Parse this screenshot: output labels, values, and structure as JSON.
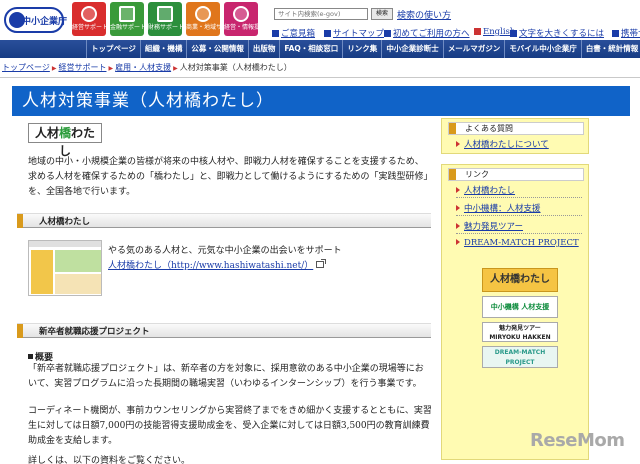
{
  "header": {
    "logo_text": "中小企業庁",
    "categories": [
      {
        "label": "経営サポート",
        "color": "#d92d2d"
      },
      {
        "label": "金融サポート",
        "color": "#3a9a3a"
      },
      {
        "label": "財務サポート",
        "color": "#2c8f3c"
      },
      {
        "label": "商業・地域サポート",
        "color": "#e0761c"
      },
      {
        "label": "経営・情報提供",
        "color": "#c8266e"
      }
    ],
    "search_placeholder": "サイト内検索(e-gov)",
    "search_button": "検索",
    "search_help": "検索の使い方",
    "utility_links": [
      "ご意見箱",
      "サイトマップ",
      "初めてご利用の方へ",
      "English",
      "文字を大きくするには",
      "携帯サイト"
    ]
  },
  "nav": [
    "トップページ",
    "組織・機構",
    "公募・公開情報",
    "出版物",
    "FAQ・相談窓口",
    "リンク集",
    "中小企業診断士",
    "メールマガジン",
    "モバイル中小企業庁",
    "白書・統計情報"
  ],
  "breadcrumb": {
    "items": [
      "トップページ",
      "経営サポート",
      "雇用・人材支援"
    ],
    "current": "人材対策事業（人材橋わたし）"
  },
  "page_title": "人材対策事業（人材橋わたし）",
  "brand": {
    "pre": "人材",
    "hl": "橋",
    "post": "わたし"
  },
  "intro": "地域の中小・小規模企業の皆様が将来の中核人材や、即戦力人材を確保することを支援するため、求める人材を確保するための「橋わたし」と、即戦力として働けるようにするための「実践型研修」を、全国各地で行います。",
  "section1": {
    "heading": "人材橋わたし",
    "lead": "やる気のある人材と、元気な中小企業の出会いをサポート",
    "link": "人材橋わたし（http://www.hashiwatashi.net/）"
  },
  "section2": {
    "heading": "新卒者就職応援プロジェクト",
    "overview_heading": "概要",
    "para1": "「新卒者就職応援プロジェクト」は、新卒者の方を対象に、採用意欲のある中小企業の現場等において、実習プログラムに沿った長期間の職場実習（いわゆるインターンシップ）を行う事業です。",
    "para2": "コーディネート機関が、事前カウンセリングから実習終了までをきめ細かく支援するとともに、実習生に対しては日額7,000円の技能習得支援助成金を、受入企業に対しては日額3,500円の教育訓練費助成金を支給します。",
    "para3": "詳しくは、以下の資料をご覧ください。"
  },
  "sidebar": {
    "faq_heading": "よくある質問",
    "faq_links": [
      "人材橋わたしについて"
    ],
    "link_heading": "リンク",
    "links": [
      "人材橋わたし",
      "中小機構：人材支援",
      "魅力発見ツアー",
      "DREAM-MATCH PROJECT"
    ],
    "banners": [
      "人材橋わたし",
      "中小機構 人材支援",
      "魅力発見ツアー MIRYOKU HAKKEN",
      "DREAM-MATCH PROJECT"
    ]
  },
  "watermark": "ReseMom"
}
